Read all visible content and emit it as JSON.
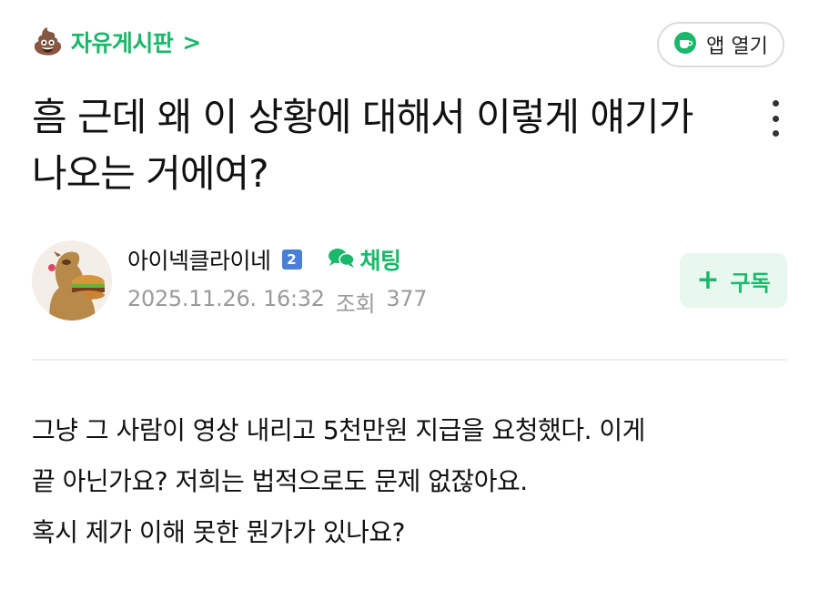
{
  "header": {
    "board_emoji": "💩",
    "board_name": "자유게시판",
    "board_chevron": ">",
    "app_button_label": "앱 열기",
    "app_icon": "cup-icon"
  },
  "post": {
    "title": "흠 근데 왜 이 상황에 대해서 이렇게 얘기가 나오는 거에여?",
    "author": {
      "name": "아이넥클라이네",
      "level_badge": "2",
      "chat_label": "채팅",
      "avatar": "camel-eating-burger"
    },
    "date": "2025.11.26. 16:32",
    "views_label": "조회",
    "views_count": "377",
    "subscribe_plus": "+",
    "subscribe_label": "구독",
    "body_lines": [
      "그냥 그 사람이 영상 내리고 5천만원 지급을 요청했다. 이게",
      "끝 아닌가요? 저희는 법적으로도 문제 없잖아요.",
      "혹시 제가 이해 못한 뭔가가 있나요?"
    ]
  },
  "colors": {
    "accent_green": "#19b86a",
    "subscribe_bg": "#e9f8ef",
    "meta_gray": "#9a9a9a",
    "badge_blue": "#4a7fd8"
  }
}
